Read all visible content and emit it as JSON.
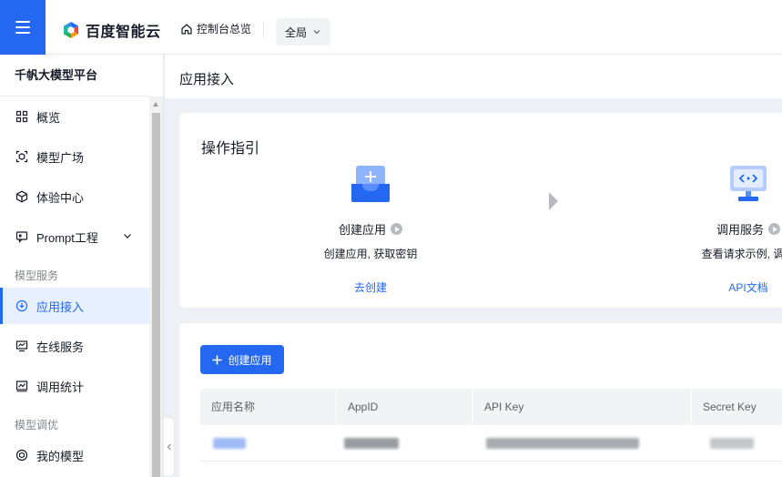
{
  "topbar": {
    "brand": "百度智能云",
    "console_label": "控制台总览",
    "region_value": "全局"
  },
  "sidebar": {
    "title": "千帆大模型平台",
    "items": [
      {
        "label": "概览",
        "icon": "grid-icon"
      },
      {
        "label": "模型广场",
        "icon": "model-square-icon"
      },
      {
        "label": "体验中心",
        "icon": "cube-icon"
      },
      {
        "label": "Prompt工程",
        "icon": "prompt-icon"
      }
    ],
    "group_service": "模型服务",
    "service_items": [
      {
        "label": "应用接入",
        "icon": "app-access-icon",
        "active": true
      },
      {
        "label": "在线服务",
        "icon": "monitor-icon"
      },
      {
        "label": "调用统计",
        "icon": "chart-icon"
      }
    ],
    "group_tuning": "模型调优",
    "tuning_items": [
      {
        "label": "我的模型",
        "icon": "my-model-icon"
      }
    ]
  },
  "page": {
    "title": "应用接入"
  },
  "guide": {
    "title": "操作指引",
    "steps": [
      {
        "name": "创建应用",
        "desc": "创建应用, 获取密钥",
        "link": "去创建",
        "icon": "create-app-icon"
      },
      {
        "name": "调用服务",
        "desc": "查看请求示例, 调用",
        "link": "API文档",
        "icon": "call-service-icon"
      }
    ]
  },
  "list": {
    "create_button": "创建应用",
    "columns": [
      "应用名称",
      "AppID",
      "API Key",
      "Secret Key"
    ]
  },
  "colors": {
    "primary": "#2468f2",
    "active_bg": "#e6f0ff"
  }
}
